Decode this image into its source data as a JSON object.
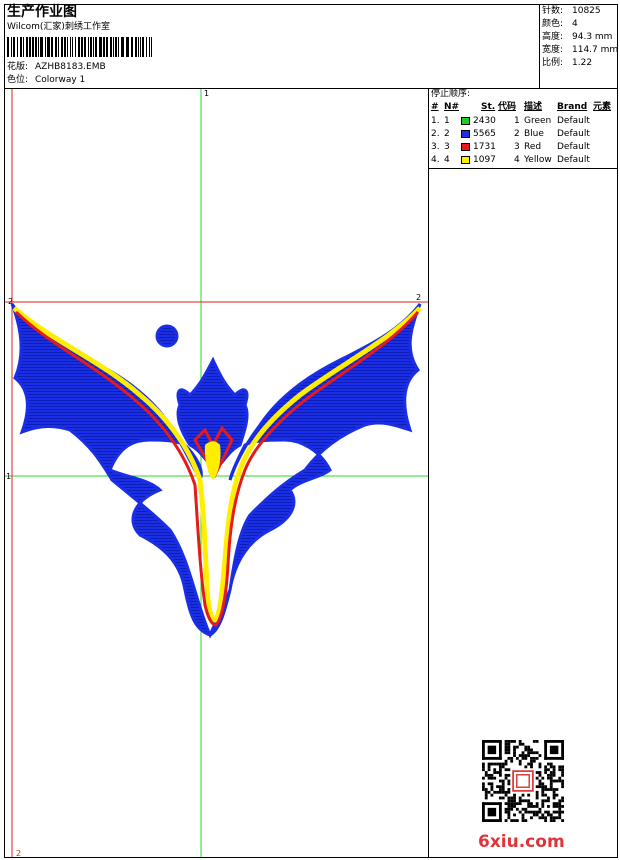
{
  "header": {
    "title": "生产作业图",
    "company": "Wilcom(汇家)刺绣工作室",
    "design_label": "花版:",
    "design_value": "AZHB8183.EMB",
    "colorway_label": "色位:",
    "colorway_value": "Colorway 1"
  },
  "stats": [
    {
      "label": "针数:",
      "value": "10825"
    },
    {
      "label": "颜色:",
      "value": "4"
    },
    {
      "label": "高度:",
      "value": "94.3 mm"
    },
    {
      "label": "宽度:",
      "value": "114.7 mm"
    },
    {
      "label": "比例:",
      "value": "1.22"
    }
  ],
  "stop_sequence": {
    "title": "停止顺序:",
    "columns": [
      "#",
      "N#",
      "St.",
      "代码",
      "描述",
      "Brand",
      "元素"
    ],
    "rows": [
      {
        "idx": "1.",
        "n": "1",
        "color": "#22cc22",
        "st": "2430",
        "code": "1",
        "desc": "Green",
        "brand": "Default"
      },
      {
        "idx": "2.",
        "n": "2",
        "color": "#1a2ee6",
        "st": "5565",
        "code": "2",
        "desc": "Blue",
        "brand": "Default"
      },
      {
        "idx": "3.",
        "n": "3",
        "color": "#e61a1a",
        "st": "1731",
        "code": "3",
        "desc": "Red",
        "brand": "Default"
      },
      {
        "idx": "4.",
        "n": "4",
        "color": "#ffee00",
        "st": "1097",
        "code": "4",
        "desc": "Yellow",
        "brand": "Default"
      }
    ]
  },
  "axis_marks": {
    "top": "1",
    "left": "1",
    "left_red": "2",
    "right_red": "2",
    "bottom": "2"
  },
  "watermark": "6xiu.com",
  "colors": {
    "green_guide": "#22dd22",
    "red_guide": "#dd2222",
    "blue": "#1a2ee6",
    "red": "#e61a1a",
    "yellow": "#ffee00"
  }
}
